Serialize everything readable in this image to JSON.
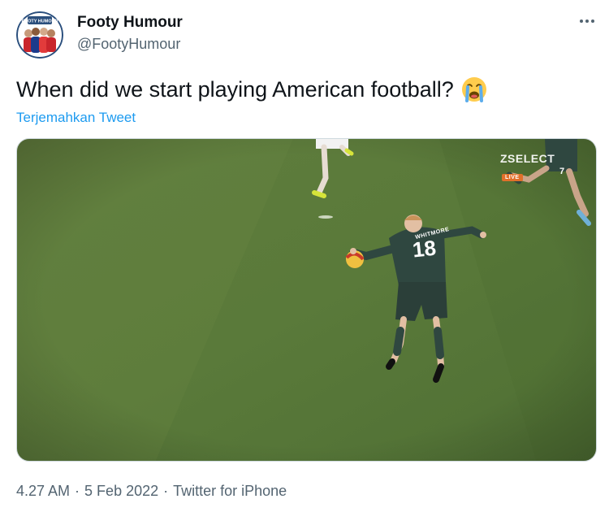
{
  "tweet": {
    "author": {
      "display_name": "Footy Humour",
      "handle": "@FootyHumour",
      "avatar_badge": "FOOTY HUMOUR"
    },
    "text": "When did we start playing American football?",
    "emoji": "loudly-crying-face",
    "translate_label": "Terjemahkan Tweet",
    "media": {
      "broadcaster": "ZSELECT",
      "live_label": "LIVE",
      "player_name": "WHITMORE",
      "player_number": "18",
      "background_player_number": "7"
    },
    "time": "4.27 AM",
    "date": "5 Feb 2022",
    "separator": "·",
    "source": "Twitter for iPhone"
  },
  "colors": {
    "text_primary": "#0f1419",
    "text_secondary": "#536471",
    "link": "#1d9bf0",
    "pitch": "#5a7a3a",
    "kit": "#2f4740",
    "live_badge": "#e0702a"
  },
  "icons": {
    "more": "more-horizontal-icon"
  }
}
